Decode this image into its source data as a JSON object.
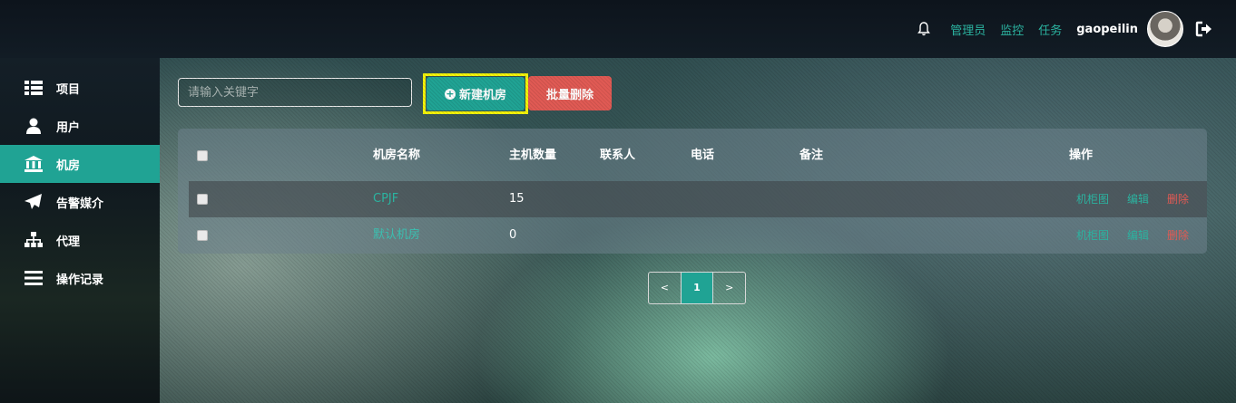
{
  "header": {
    "notification_icon": "bell-icon",
    "links": [
      "管理员",
      "监控",
      "任务"
    ],
    "username": "gaopeilin",
    "logout_icon": "logout-icon",
    "link_color": "#2bb3a0"
  },
  "sidebar": {
    "items": [
      {
        "label": "项目",
        "icon": "list-icon",
        "active": false
      },
      {
        "label": "用户",
        "icon": "user-icon",
        "active": false
      },
      {
        "label": "机房",
        "icon": "bank-icon",
        "active": true
      },
      {
        "label": "告警媒介",
        "icon": "paper-plane-icon",
        "active": false
      },
      {
        "label": "代理",
        "icon": "sitemap-icon",
        "active": false
      },
      {
        "label": "操作记录",
        "icon": "bars-icon",
        "active": false
      }
    ],
    "active_color": "#20a394"
  },
  "toolbar": {
    "search_placeholder": "请输入关键字",
    "new_label": "新建机房",
    "new_icon": "plus-circle-icon",
    "delete_label": "批量删除",
    "highlight_color": "#f3f30a",
    "danger_color": "#e05a54"
  },
  "table": {
    "columns": [
      "机房名称",
      "主机数量",
      "联系人",
      "电话",
      "备注",
      "操作"
    ],
    "rows": [
      {
        "name": "CPJF",
        "hosts": "15",
        "contact": "",
        "phone": "",
        "note": "",
        "actions": [
          "机柜图",
          "编辑",
          "删除"
        ]
      },
      {
        "name": "默认机房",
        "hosts": "0",
        "contact": "",
        "phone": "",
        "note": "",
        "actions": [
          "机柜图",
          "编辑",
          "删除"
        ]
      }
    ]
  },
  "pagination": {
    "prev": "<",
    "current": "1",
    "next": ">"
  }
}
